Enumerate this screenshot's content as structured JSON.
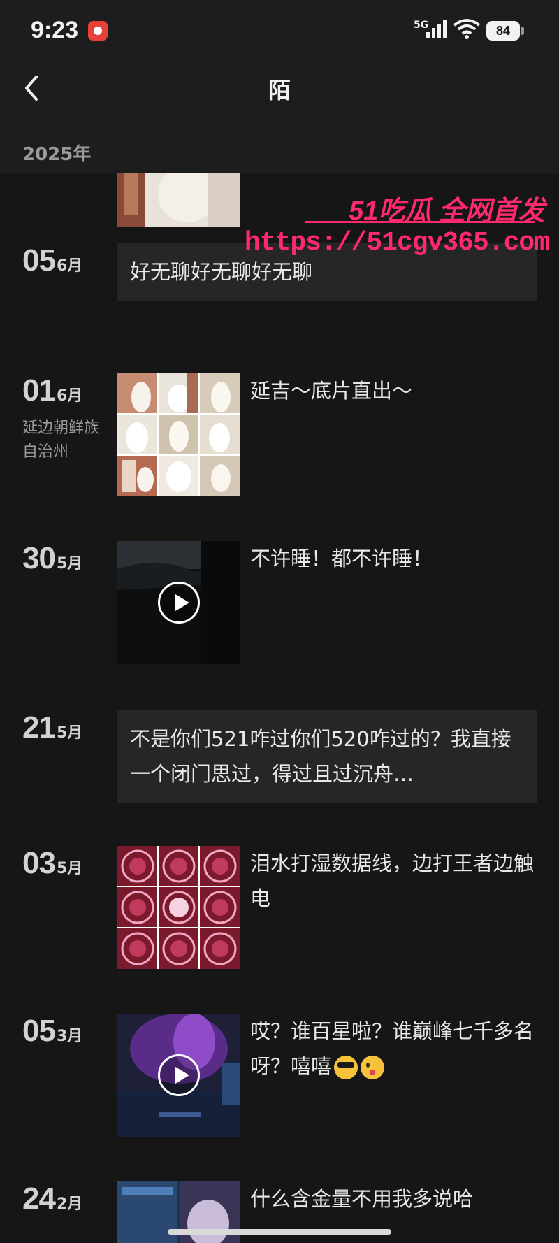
{
  "status_bar": {
    "time": "9:23",
    "network": "5G",
    "battery": "84"
  },
  "header": {
    "title": "陌",
    "year": "2025年"
  },
  "watermark": {
    "text": "51吃瓜 全网首发",
    "url": "https://51cgv365.com"
  },
  "posts": [
    {
      "day": "05",
      "month": "6月",
      "location": "",
      "media": "none",
      "text": "好无聊好无聊好无聊"
    },
    {
      "day": "01",
      "month": "6月",
      "location": "延边朝鲜族自治州",
      "media": "photo-grid",
      "text": "延吉～底片直出～"
    },
    {
      "day": "30",
      "month": "5月",
      "location": "",
      "media": "video",
      "text": "不许睡！都不许睡！"
    },
    {
      "day": "21",
      "month": "5月",
      "location": "",
      "media": "none",
      "text": "不是你们521咋过你们520咋过的？我直接一个闭门思过，得过且过沉舟…"
    },
    {
      "day": "03",
      "month": "5月",
      "location": "",
      "media": "photo-grid",
      "text": "泪水打湿数据线，边打王者边触电"
    },
    {
      "day": "05",
      "month": "3月",
      "location": "",
      "media": "video",
      "text": "哎？谁百星啦？谁巅峰七千多名呀？嘻嘻"
    },
    {
      "day": "24",
      "month": "2月",
      "location": "",
      "media": "photo",
      "text": "什么含金量不用我多说哈"
    }
  ],
  "colors": {
    "background": "#161616",
    "header_bg": "#1d1d1d",
    "card_bg": "#262626",
    "watermark": "#ff2a6d"
  }
}
